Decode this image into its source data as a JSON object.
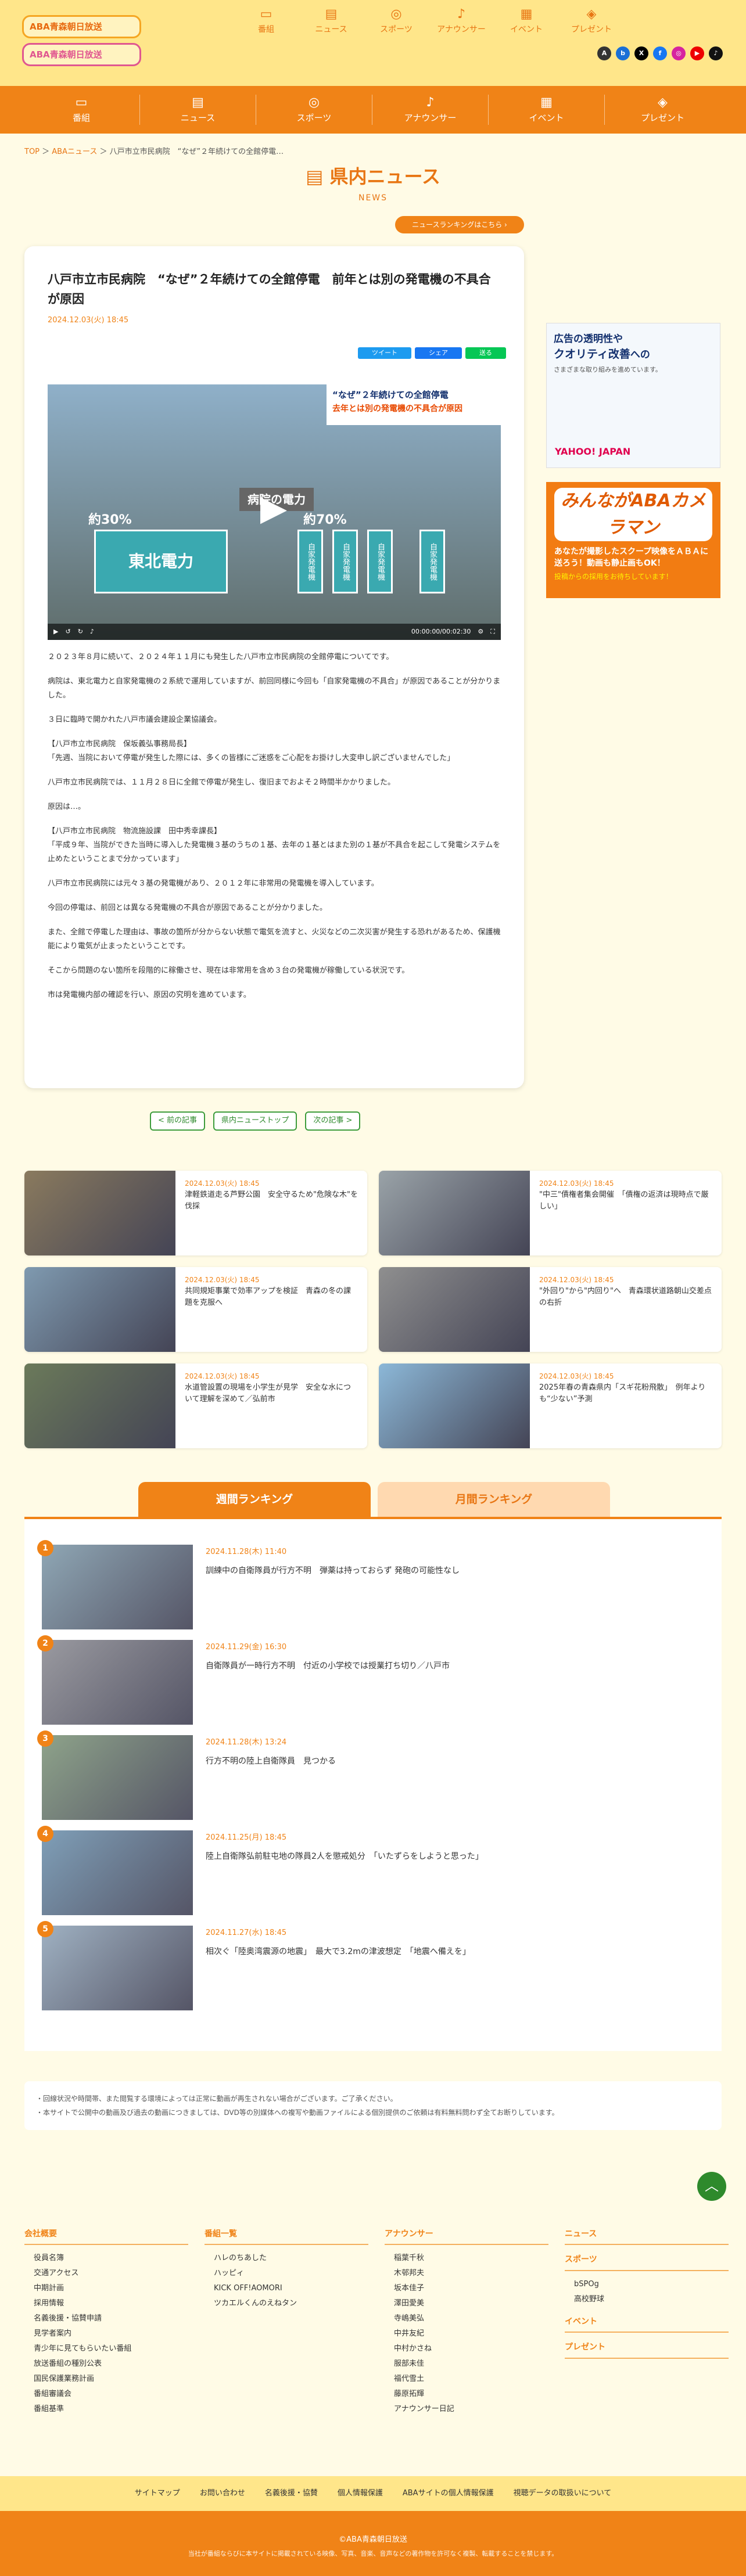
{
  "logo": {
    "line1": "ABA青森朝日放送",
    "line2": "ABA青森朝日放送"
  },
  "topnav": [
    {
      "label": "番組",
      "icon": "tv-icon"
    },
    {
      "label": "ニュース",
      "icon": "news-icon"
    },
    {
      "label": "スポーツ",
      "icon": "ball-icon"
    },
    {
      "label": "アナウンサー",
      "icon": "mic-icon"
    },
    {
      "label": "イベント",
      "icon": "calendar-icon"
    },
    {
      "label": "プレゼント",
      "icon": "gift-icon"
    }
  ],
  "breadcrumb": {
    "home": "TOP",
    "news": "ABAニュース",
    "current": "八戸市立市民病院　“なぜ”２年続けての全館停電…"
  },
  "heading": {
    "title": "県内ニュース",
    "sub": "NEWS"
  },
  "ranking_link": "ニュースランキングはこちら",
  "article": {
    "title": "八戸市立市民病院　“なぜ”２年続けての全館停電　前年とは別の発電機の不具合が原因",
    "date": "2024.12.03(火) 18:45",
    "share": {
      "tweet": "ツイート",
      "facebook": "シェア",
      "line": "送る"
    },
    "video": {
      "caption_a": "“なぜ”２年続けての全館停電",
      "caption_b": "去年とは別の発電機の不具合が原因",
      "box": "東北電力",
      "pct1": "約30%",
      "pct2": "約70%",
      "label": "病院の電力",
      "gen": "自家発電機",
      "time": "00:00:00/00:02:30"
    },
    "paragraphs": [
      "２０２３年８月に続いて、２０２４年１１月にも発生した八戸市立市民病院の全館停電についてです。",
      "病院は、東北電力と自家発電機の２系統で運用していますが、前回同様に今回も「自家発電機の不具合」が原因であることが分かりました。",
      "３日に臨時で開かれた八戸市議会建設企業協議会。",
      "【八戸市立市民病院　保坂義弘事務局長】\n「先週、当院において停電が発生した際には、多くの皆様にご迷惑をご心配をお掛けし大変申し訳ございませんでした」",
      "八戸市立市民病院では、１１月２８日に全館で停電が発生し、復旧までおよそ２時間半かかりました。",
      "原因は…。",
      "【八戸市立市民病院　物流施設課　田中秀幸課長】\n「平成９年、当院ができた当時に導入した発電機３基のうちの１基、去年の１基とはまた別の１基が不具合を起こして発電システムを止めたということまで分かっています」",
      "八戸市立市民病院には元々３基の発電機があり、２０１２年に非常用の発電機を導入しています。",
      "今回の停電は、前回とは異なる発電機の不具合が原因であることが分かりました。",
      "また、全館で停電した理由は、事故の箇所が分からない状態で電気を流すと、火災などの二次災害が発生する恐れがあるため、保護機能により電気が止まったということです。",
      "そこから問題のない箇所を段階的に稼働させ、現在は非常用を含め３台の発電機が稼働している状況です。",
      "市は発電機内部の確認を行い、原因の究明を進めています。"
    ]
  },
  "sidebar": {
    "ad1_a": "広告の透明性や",
    "ad1_b": "クオリティ改善",
    "ad1_c": "への",
    "ad1_sub": "さまざまな取り組みを進めています。",
    "ad1_brand": "YAHOO! JAPAN",
    "ad2_head": "みんながABAカメラマン",
    "ad2_body": "あなたが撮影したスクープ映像をＡＢＡに送ろう！動画も静止画もOK！",
    "ad2_sub": "投稿からの採用をお待ちしています！"
  },
  "pager": {
    "prev": "< 前の記事",
    "top": "県内ニューストップ",
    "next": "次の記事 >"
  },
  "related": [
    {
      "date": "2024.12.03(火) 18:45",
      "title": "津軽鉄道走る芦野公園　安全守るため\"危険な木\"を伐採",
      "color": "#8a7a5e"
    },
    {
      "date": "2024.12.03(火) 18:45",
      "title": "\"中三\"債権者集会開催　「債権の返済は現時点で厳しい」",
      "color": "#9aa3a8"
    },
    {
      "date": "2024.12.03(火) 18:45",
      "title": "共同規矩事業で効率アップを検証　青森の冬の課題を克服へ",
      "color": "#7f9ab0"
    },
    {
      "date": "2024.12.03(火) 18:45",
      "title": "\"外回り\"から\"内回り\"へ　青森環状道路朝山交差点の右折",
      "color": "#8f8f8f"
    },
    {
      "date": "2024.12.03(火) 18:45",
      "title": "水道管設置の現場を小学生が見学　安全な水について理解を深めて／弘前市",
      "color": "#6b7a5a"
    },
    {
      "date": "2024.12.03(火) 18:45",
      "title": "2025年春の青森県内「スギ花粉飛散」　例年よりも“少ない”予測",
      "color": "#8cb8d8"
    }
  ],
  "tabs": {
    "weekly": "週間ランキング",
    "monthly": "月間ランキング"
  },
  "ranking": [
    {
      "rank": "1",
      "date": "2024.11.28(木) 11:40",
      "title": "訓練中の自衛隊員が行方不明　弾薬は持っておらず 発砲の可能性なし",
      "color": "#8fa7b5"
    },
    {
      "rank": "2",
      "date": "2024.11.29(金) 16:30",
      "title": "自衛隊員が一時行方不明　付近の小学校では授業打ち切り／八戸市",
      "color": "#9a9aa0"
    },
    {
      "rank": "3",
      "date": "2024.11.28(木) 13:24",
      "title": "行方不明の陸上自衛隊員　見つかる",
      "color": "#8ea38a"
    },
    {
      "rank": "4",
      "date": "2024.11.25(月) 18:45",
      "title": "陸上自衛隊弘前駐屯地の隊員2人を懲戒処分　「いたずらをしようと思った」",
      "color": "#7f9fb8"
    },
    {
      "rank": "5",
      "date": "2024.11.27(水) 18:45",
      "title": "相次ぐ「陸奥湾震源の地震」　最大で3.2mの津波想定　「地震へ備えを」",
      "color": "#9fb1c2"
    }
  ],
  "notes": [
    "・回線状況や時間帯、また閲覧する環境によっては正常に動画が再生されない場合がございます。ご了承ください。",
    "・本サイトで公開中の動画及び過去の動画につきましては、DVD等の別媒体への複写や動画ファイルによる個別提供のご依頼は有料無料問わず全てお断りしています。"
  ],
  "footer": {
    "cols": [
      {
        "title": "会社概要",
        "items": [
          "役員名簿",
          "交通アクセス",
          "中期計画",
          "採用情報",
          "名義後援・協賛申請",
          "見学者案内",
          "青少年に見てもらいたい番組",
          "放送番組の種別公表",
          "国民保護業務計画",
          "番組審議会",
          "番組基準"
        ]
      },
      {
        "title": "番組一覧",
        "items": [
          "ハレのちあした",
          "ハッピィ",
          "KICK OFF!AOMORI",
          "ツカエルくんのえねタン"
        ]
      },
      {
        "title": "アナウンサー",
        "items": [
          "稲葉千秋",
          "木邨邦夫",
          "坂本佳子",
          "澤田愛美",
          "寺嶋美弘",
          "中井友紀",
          "中村かさね",
          "服部未佳",
          "福代雪土",
          "藤原拓輝",
          "アナウンサー日記"
        ]
      },
      {
        "title": "ニュース",
        "sub": [
          {
            "title": "スポーツ",
            "items": [
              "bSPOg",
              "高校野球"
            ]
          },
          {
            "title": "イベント",
            "items": []
          },
          {
            "title": "プレゼント",
            "items": []
          }
        ]
      }
    ],
    "bar": [
      "サイトマップ",
      "お問い合わせ",
      "名義後援・協賛",
      "個人情報保護",
      "ABAサイトの個人情報保護",
      "視聴データの取扱いについて"
    ],
    "copyright": "©ABA青森朝日放送",
    "copy_sub": "当社が番組ならびに本サイトに掲載されている映像、写真、音楽、音声などの著作物を許可なく複製、転載することを禁じます。"
  },
  "colors": {
    "accent": "#f08317",
    "header": "#ffe68a",
    "bg": "#fffbe6"
  }
}
